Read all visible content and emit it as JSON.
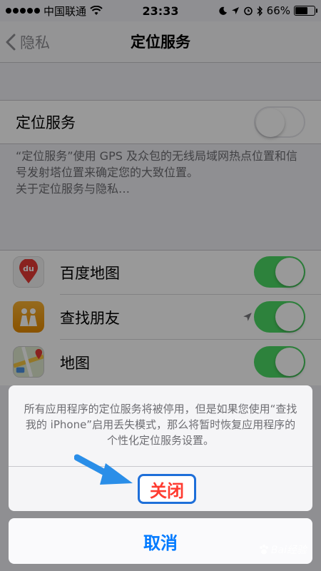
{
  "status_bar": {
    "carrier": "中国联通",
    "time": "23:33",
    "battery_percent": "66%",
    "battery_level": 0.66
  },
  "nav": {
    "back_label": "隐私",
    "title": "定位服务"
  },
  "location_services": {
    "label": "定位服务",
    "enabled": false
  },
  "footnote": {
    "text": "“定位服务”使用 GPS 及众包的无线局域网热点位置和信号发射塔位置来确定您的大致位置。",
    "link": "关于定位服务与隐私…"
  },
  "apps": [
    {
      "name": "百度地图",
      "icon": "baidu-maps-icon",
      "enabled": true
    },
    {
      "name": "查找朋友",
      "icon": "find-friends-icon",
      "enabled": true,
      "location_arrow": true
    },
    {
      "name": "地图",
      "icon": "maps-icon",
      "enabled": true
    }
  ],
  "action_sheet": {
    "message": "所有应用程序的定位服务将被停用，但是如果您使用“查找我的 iPhone”启用丢失模式，那么将暂时恢复应用程序的个性化定位服务设置。",
    "close_label": "关闭",
    "cancel_label": "取消"
  },
  "watermark": {
    "text": "Bai经验"
  },
  "colors": {
    "toggle_on": "#4cd964",
    "destructive": "#ff3b30",
    "tint": "#007aff",
    "highlight_border": "#1e6fd9",
    "arrow": "#2a8ee8"
  }
}
